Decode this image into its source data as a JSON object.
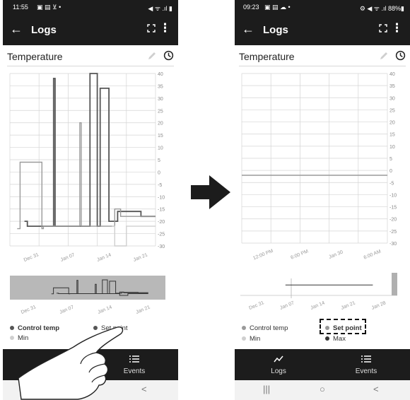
{
  "colors": {
    "bar": "#1c1c1c",
    "control": "#555555",
    "setpoint": "#9a9a9a",
    "min": "#cfcfcf",
    "grid": "#d4d4d4",
    "nav_bg": "#1c1c1c"
  },
  "screen_before": {
    "status": {
      "time": "11:55",
      "icons": "▣ ▤ ⊻ •",
      "right_icons": "◀ ᯤ .ıl ▮"
    },
    "appbar": {
      "title": "Logs",
      "back_icon": "arrow-left-icon",
      "expand_icon": "fullscreen-icon",
      "more_icon": "more-vert-icon"
    },
    "chart_title": "Temperature",
    "legend": {
      "control": "Control temp",
      "setpoint": "Set point",
      "min": "Min"
    },
    "nav": {
      "events": "Events"
    }
  },
  "screen_after": {
    "status": {
      "time": "09:23",
      "icons": "▣ ▤ ☁ •",
      "right_icons": "⚙ ◀ ᯤ .ıl 88%▮"
    },
    "appbar": {
      "title": "Logs"
    },
    "chart_title": "Temperature",
    "legend": {
      "control": "Control temp",
      "setpoint": "Set point",
      "min": "Min",
      "max": "Max"
    },
    "nav": {
      "logs": "Logs",
      "events": "Events"
    }
  },
  "sysnav": {
    "recent": "|||",
    "home": "○",
    "back": "<"
  },
  "chart_data": [
    {
      "type": "line",
      "title": "Temperature",
      "ylim": [
        -30,
        40
      ],
      "yticks": [
        "40",
        "35",
        "30",
        "25",
        "20",
        "15",
        "10",
        "5",
        "0",
        "-5",
        "-10",
        "-15",
        "-20",
        "-25",
        "-30"
      ],
      "xticks": [
        "Dec 31",
        "Jan 07",
        "Jan 14",
        "Jan 21"
      ],
      "navigator_xticks": [
        "Dec 31",
        "Jan 07",
        "Jan 14",
        "Jan 21"
      ],
      "series": [
        {
          "name": "Control temp",
          "x": [
            0.1,
            0.12,
            0.12,
            0.3,
            0.3,
            0.31,
            0.31,
            0.55,
            0.55,
            0.6,
            0.6,
            0.62,
            0.62,
            0.68,
            0.68,
            0.74,
            0.74,
            0.9,
            0.9,
            1.0
          ],
          "y": [
            -20,
            -20,
            -22,
            -22,
            38,
            38,
            -22,
            -22,
            40,
            40,
            -22,
            -22,
            34,
            34,
            -20,
            -20,
            -16,
            -16,
            -18,
            -18
          ]
        },
        {
          "name": "Set point",
          "x": [
            0.05,
            0.07,
            0.07,
            0.22,
            0.22,
            0.23,
            0.23,
            0.48,
            0.48,
            0.49,
            0.49,
            0.72,
            0.72,
            0.76,
            0.76,
            1.0
          ],
          "y": [
            -23,
            -23,
            4,
            4,
            -23,
            -23,
            -22,
            -22,
            20,
            20,
            -22,
            -22,
            -15,
            -15,
            -18,
            -18
          ]
        },
        {
          "name": "Min",
          "x": [
            0.7,
            0.72,
            0.72,
            0.8,
            0.8,
            1.0
          ],
          "y": [
            -22,
            -22,
            -30,
            -30,
            -22,
            -22
          ]
        }
      ]
    },
    {
      "type": "line",
      "title": "Temperature",
      "ylim": [
        -30,
        40
      ],
      "yticks": [
        "40",
        "35",
        "30",
        "25",
        "20",
        "15",
        "10",
        "5",
        "0",
        "-5",
        "-10",
        "-15",
        "-20",
        "-25",
        "-30"
      ],
      "xticks": [
        "12:00 PM",
        "6:00 PM",
        "Jan 30",
        "6:00 AM"
      ],
      "navigator_xticks": [
        "Dec 31",
        "Jan 07",
        "Jan 14",
        "Jan 21",
        "Jan 28"
      ],
      "series": [
        {
          "name": "Set point",
          "x": [
            0.0,
            1.0
          ],
          "y": [
            -2,
            -2
          ]
        }
      ]
    }
  ]
}
